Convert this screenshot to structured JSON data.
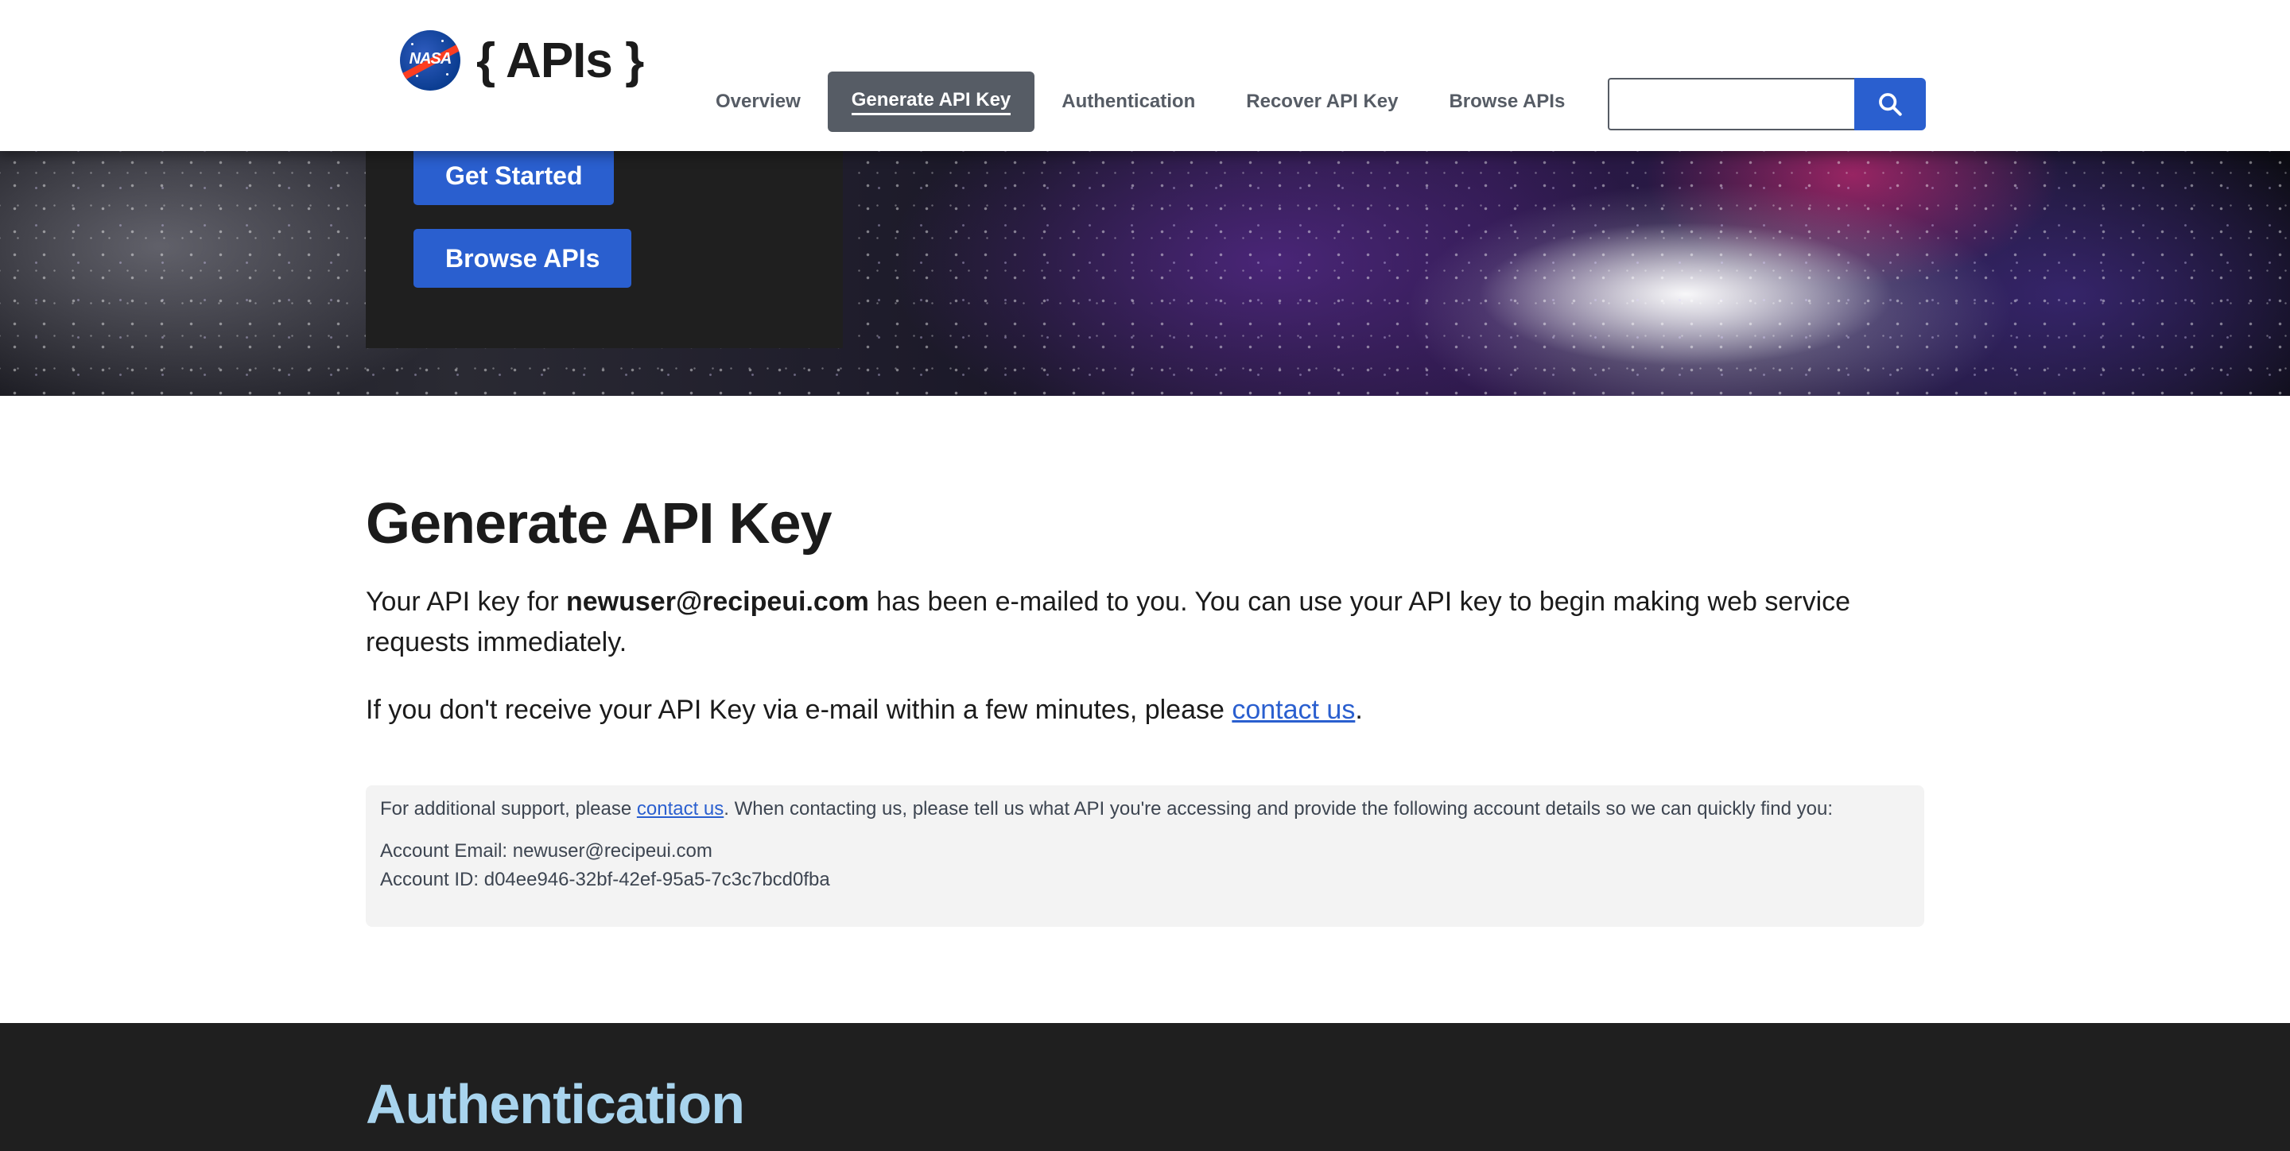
{
  "header": {
    "logo_text": "{ APIs }",
    "logo_badge": "NASA",
    "nav": [
      {
        "label": "Overview",
        "active": false
      },
      {
        "label": "Generate API Key",
        "active": true
      },
      {
        "label": "Authentication",
        "active": false
      },
      {
        "label": "Recover API Key",
        "active": false
      },
      {
        "label": "Browse APIs",
        "active": false
      }
    ],
    "search": {
      "value": "",
      "placeholder": ""
    }
  },
  "hero": {
    "get_started_label": "Get Started",
    "browse_label": "Browse APIs"
  },
  "main": {
    "title": "Generate API Key",
    "para1_prefix": "Your API key for ",
    "para1_email": "newuser@recipeui.com",
    "para1_suffix": " has been e-mailed to you. You can use your API key to begin making web service requests immediately.",
    "para2_prefix": "If you don't receive your API Key via e-mail within a few minutes, please ",
    "para2_link": "contact us",
    "para2_suffix": ".",
    "support": {
      "prefix": "For additional support, please ",
      "link": "contact us",
      "suffix": ". When contacting us, please tell us what API you're accessing and provide the following account details so we can quickly find you:",
      "account_email": "Account Email: newuser@recipeui.com",
      "account_id": "Account ID: d04ee946-32bf-42ef-95a5-7c3c7bcd0fba"
    }
  },
  "section": {
    "title": "Authentication"
  },
  "colors": {
    "primary": "#2a5fcf",
    "nav_active": "#565c65",
    "dark_panel": "#1f1f1f",
    "auth_title": "#a8d4ee"
  }
}
